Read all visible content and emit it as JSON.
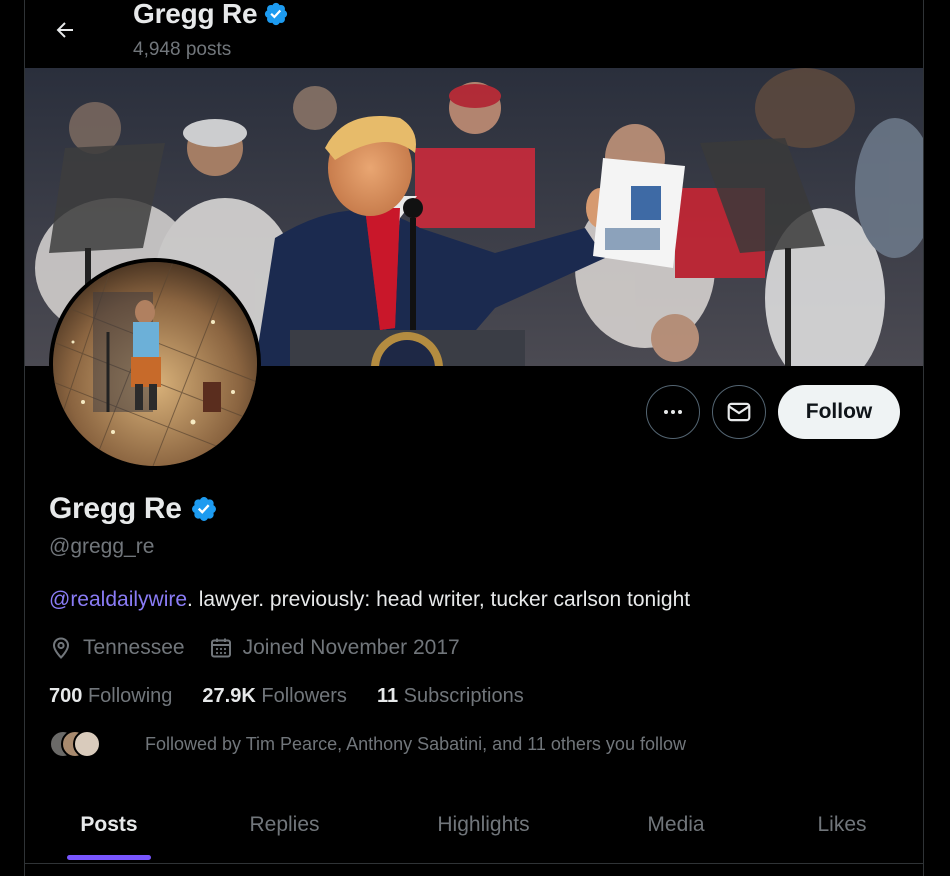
{
  "header": {
    "name": "Gregg Re",
    "posts_count": "4,948 posts"
  },
  "profile": {
    "name": "Gregg Re",
    "handle": "@gregg_re",
    "bio_link": "@realdailywire",
    "bio_rest": ". lawyer. previously: head writer, tucker carlson tonight",
    "location": "Tennessee",
    "joined": "Joined November 2017",
    "following_count": "700",
    "following_label": "Following",
    "followers_count": "27.9K",
    "followers_label": "Followers",
    "subscriptions_count": "11",
    "subscriptions_label": "Subscriptions",
    "followed_by": "Followed by Tim Pearce, Anthony Sabatini, and 11 others you follow"
  },
  "actions": {
    "follow_label": "Follow"
  },
  "tabs": [
    {
      "label": "Posts",
      "active": true
    },
    {
      "label": "Replies",
      "active": false
    },
    {
      "label": "Highlights",
      "active": false
    },
    {
      "label": "Media",
      "active": false
    },
    {
      "label": "Likes",
      "active": false
    }
  ],
  "icons": {
    "back": "arrow-left-icon",
    "verified": "verified-badge-icon",
    "more": "more-horizontal-icon",
    "message": "envelope-icon",
    "location": "location-pin-icon",
    "calendar": "calendar-icon"
  },
  "colors": {
    "accent": "#7856ff",
    "link": "#8a7cf6",
    "verified": "#1d9bf0",
    "muted": "#71767b",
    "text": "#e7e9ea"
  }
}
